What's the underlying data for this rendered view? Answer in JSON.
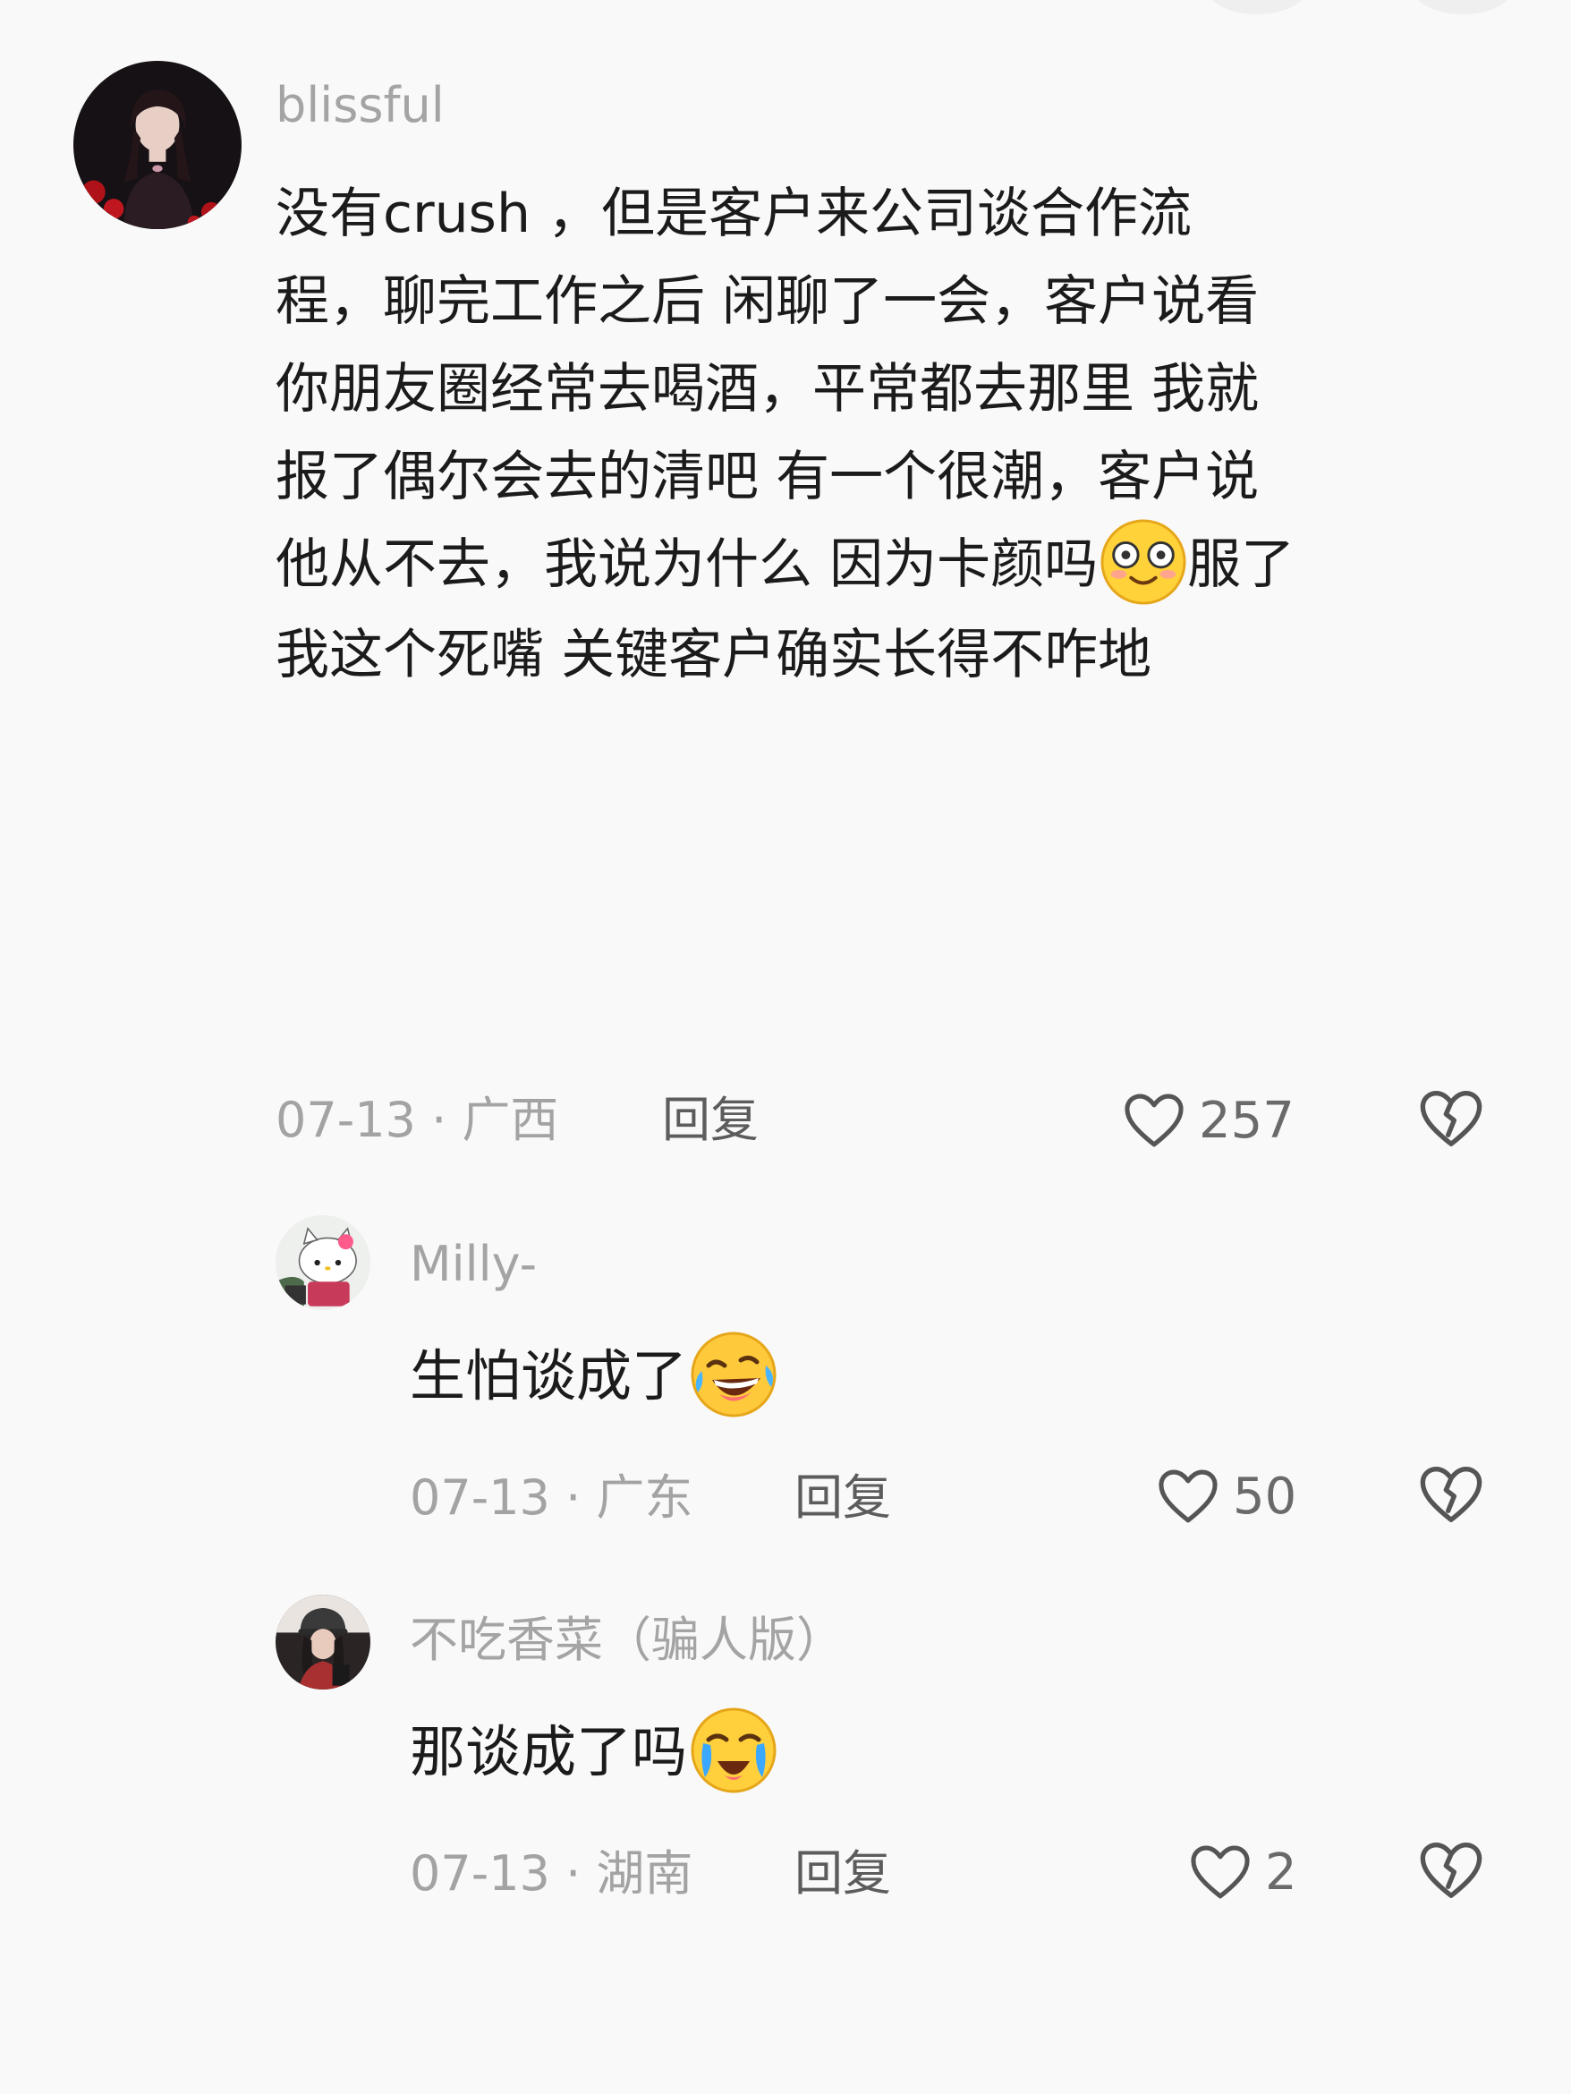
{
  "comments": [
    {
      "username": "blissful",
      "body_lines": [
        "没有crush ，但是客户来公司谈合作流",
        "程，聊完工作之后 闲聊了一会，客户说看",
        "你朋友圈经常去喝酒，平常都去那里 我就",
        "报了偶尔会去的清吧 有一个很潮，客户说",
        "他从不去，我说为什么 因为卡颜吗",
        "我这个死嘴 关键客户确实长得不咋地"
      ],
      "body_line5_suffix": "服了",
      "emoji": "flushed-face-emoji",
      "meta": "07-13 · 广西",
      "reply_label": "回复",
      "like_count": "257"
    },
    {
      "username": "Milly-",
      "body": "生怕谈成了",
      "emoji": "rolling-laughing-emoji",
      "meta": "07-13 · 广东",
      "reply_label": "回复",
      "like_count": "50"
    },
    {
      "username": "不吃香菜（骗人版）",
      "body": "那谈成了吗",
      "emoji": "crying-face-emoji",
      "meta": "07-13 · 湖南",
      "reply_label": "回复",
      "like_count": "2"
    }
  ],
  "icons": {
    "like": "heart-outline-icon",
    "dislike": "broken-heart-icon"
  },
  "colors": {
    "background": "#f9f9f9",
    "username": "#a4a4a4",
    "body_text": "#1b1b1b",
    "meta": "#a3a3a3",
    "reply": "#5c5c5c",
    "icon": "#555555"
  }
}
